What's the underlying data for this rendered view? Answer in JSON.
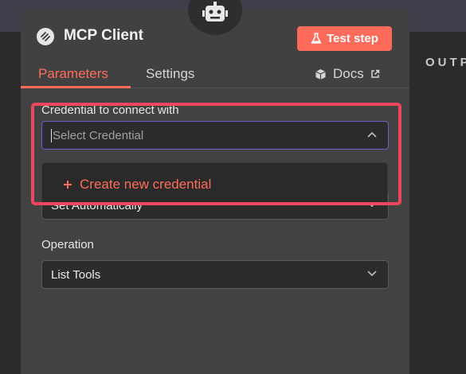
{
  "background": {
    "output_label": "OUTPUT"
  },
  "node": {
    "title": "MCP Client",
    "test_step_label": "Test step"
  },
  "tabs": [
    {
      "label": "Parameters",
      "active": true
    },
    {
      "label": "Settings",
      "active": false
    }
  ],
  "docs_label": "Docs",
  "credential": {
    "label": "Credential to connect with",
    "placeholder": "Select Credential",
    "dropdown_item": "Create new credential"
  },
  "hidden_field": {
    "value": "Set Automatically"
  },
  "operation": {
    "label": "Operation",
    "value": "List Tools"
  },
  "colors": {
    "accent": "#ff6d5a",
    "focus_border": "#6a5fc8",
    "highlight": "#f0455f"
  },
  "icons": [
    "robot-icon",
    "mcp-logo-icon",
    "flask-icon",
    "cube-icon",
    "external-link-icon",
    "chevron-down-icon",
    "chevron-up-icon",
    "plus-icon"
  ]
}
